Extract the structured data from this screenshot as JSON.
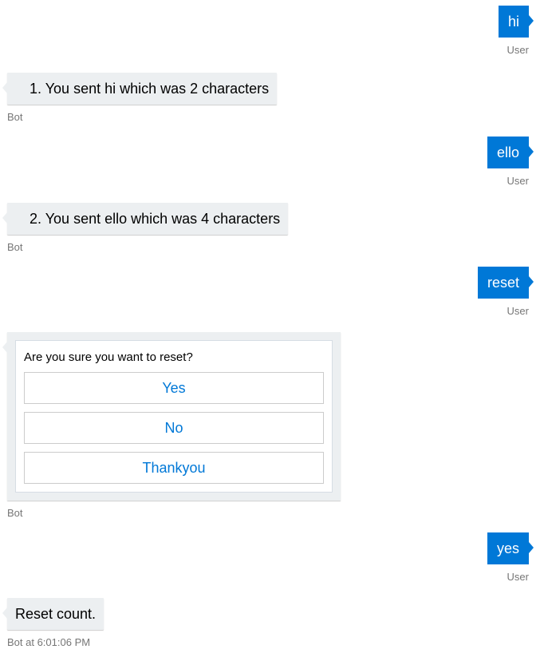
{
  "messages": [
    {
      "from": "user",
      "text": "hi",
      "meta": "User"
    },
    {
      "from": "bot",
      "text": "1. You sent hi which was 2 characters",
      "meta": "Bot"
    },
    {
      "from": "user",
      "text": "ello",
      "meta": "User"
    },
    {
      "from": "bot",
      "text": "2. You sent ello which was 4 characters",
      "meta": "Bot"
    },
    {
      "from": "user",
      "text": "reset",
      "meta": "User"
    },
    {
      "from": "bot-card",
      "meta": "Bot",
      "card": {
        "text": "Are you sure you want to reset?",
        "buttons": [
          "Yes",
          "No",
          "Thankyou"
        ]
      }
    },
    {
      "from": "user",
      "text": "yes",
      "meta": "User"
    },
    {
      "from": "bot",
      "text": "Reset count.",
      "meta": "Bot at 6:01:06 PM"
    }
  ],
  "colors": {
    "user_bubble": "#0078d7",
    "bot_bubble": "#eceff1",
    "button_text": "#0078d7"
  }
}
